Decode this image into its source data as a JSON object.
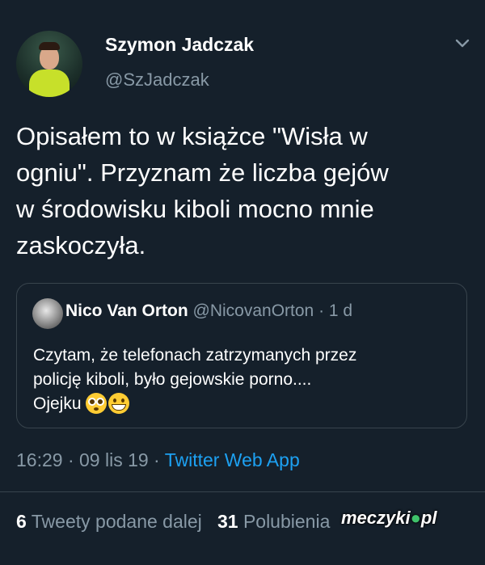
{
  "author": {
    "name": "Szymon Jadczak",
    "handle": "@SzJadczak",
    "avatar_icon": "profile-photo"
  },
  "tweet": {
    "lines": [
      "Opisałem to w książce \"Wisła w",
      "ogniu\". Przyznam że liczba gejów",
      "w środowisku kiboli mocno mnie",
      "zaskoczyła."
    ]
  },
  "quoted_tweet": {
    "name": "Nico Van Orton",
    "meta": "@NicovanOrton · 1 d",
    "lines": [
      "Czytam, że telefonach zatrzymanych przez",
      "policję kiboli, było gejowskie porno....",
      "Ojejku"
    ],
    "emojis": [
      "flushed-face",
      "grinning-face"
    ]
  },
  "timestamp": {
    "time_date": "16:29 · 09 lis 19 · ",
    "source": "Twitter Web App"
  },
  "stats": {
    "retweets_count": "6",
    "retweets_label": "Tweety podane dalej",
    "likes_count": "31",
    "likes_label": "Polubienia"
  },
  "watermark": {
    "text_main": "meczyki",
    "text_dot": "●",
    "text_tld": "pl"
  },
  "colors": {
    "background": "#15202b",
    "secondary_text": "#8899a6",
    "link": "#1da1f2",
    "border": "#38444d"
  }
}
